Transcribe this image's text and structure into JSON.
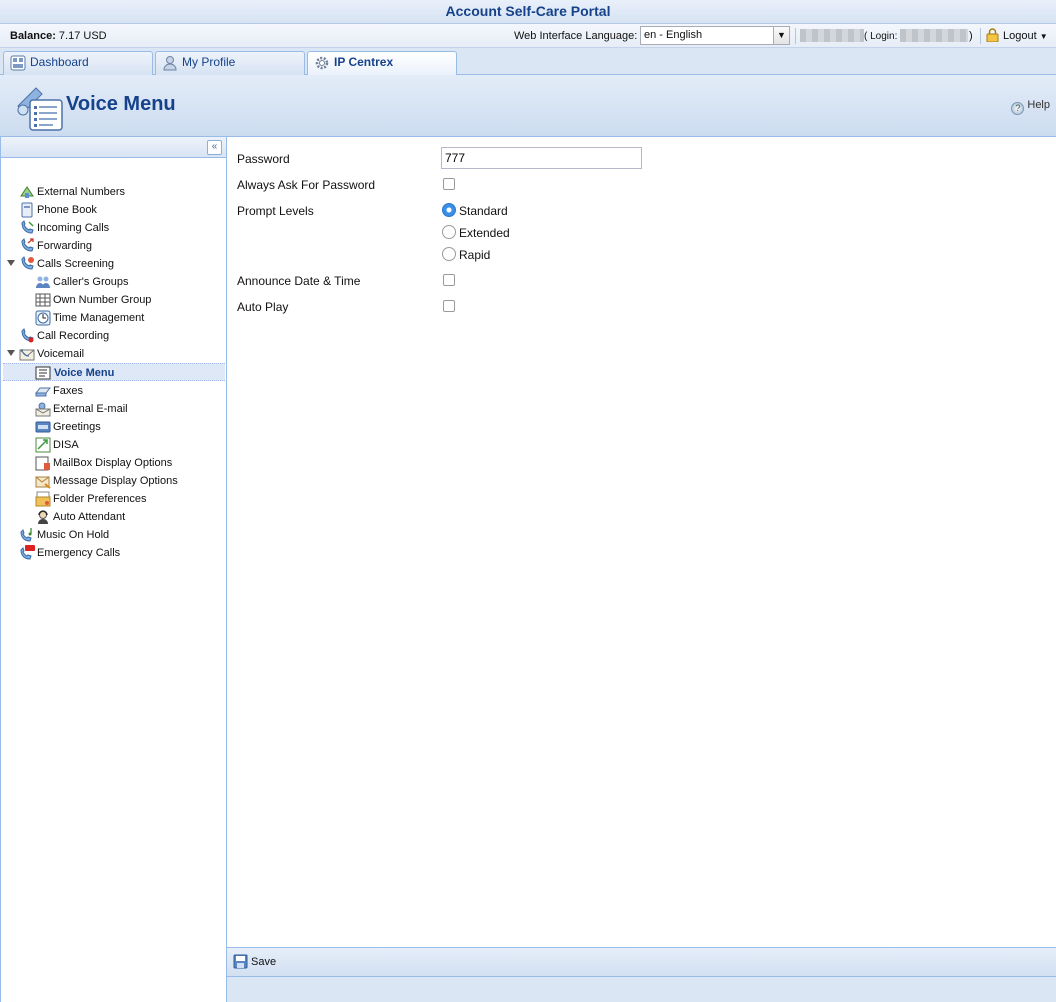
{
  "app": {
    "title": "Account Self-Care Portal"
  },
  "infobar": {
    "balance_label": "Balance:",
    "balance_value": "7.17 USD",
    "language_label": "Web Interface Language:",
    "language_value": "en - English",
    "login_label": "( Login:",
    "login_close": ")",
    "logout_label": "Logout"
  },
  "tabs": [
    {
      "label": "Dashboard"
    },
    {
      "label": "My Profile"
    },
    {
      "label": "IP Centrex"
    }
  ],
  "header": {
    "title": "Voice Menu",
    "help": "Help"
  },
  "sidebar": {
    "items": [
      {
        "label": "External Numbers"
      },
      {
        "label": "Phone Book"
      },
      {
        "label": "Incoming Calls"
      },
      {
        "label": "Forwarding"
      },
      {
        "label": "Calls Screening"
      },
      {
        "label": "Caller's Groups"
      },
      {
        "label": "Own Number Group"
      },
      {
        "label": "Time Management"
      },
      {
        "label": "Call Recording"
      },
      {
        "label": "Voicemail"
      },
      {
        "label": "Voice Menu"
      },
      {
        "label": "Faxes"
      },
      {
        "label": "External E-mail"
      },
      {
        "label": "Greetings"
      },
      {
        "label": "DISA"
      },
      {
        "label": "MailBox Display Options"
      },
      {
        "label": "Message Display Options"
      },
      {
        "label": "Folder Preferences"
      },
      {
        "label": "Auto Attendant"
      },
      {
        "label": "Music On Hold"
      },
      {
        "label": "Emergency Calls"
      }
    ]
  },
  "form": {
    "password_label": "Password",
    "password_value": "777",
    "always_ask_label": "Always Ask For Password",
    "prompt_levels_label": "Prompt Levels",
    "prompt_options": [
      "Standard",
      "Extended",
      "Rapid"
    ],
    "prompt_selected": "Standard",
    "announce_label": "Announce Date & Time",
    "autoplay_label": "Auto Play"
  },
  "footer": {
    "save_label": "Save"
  },
  "colors": {
    "accent": "#15428b",
    "panel_border": "#99bbe8",
    "selected_bg": "#dfe8f6"
  }
}
